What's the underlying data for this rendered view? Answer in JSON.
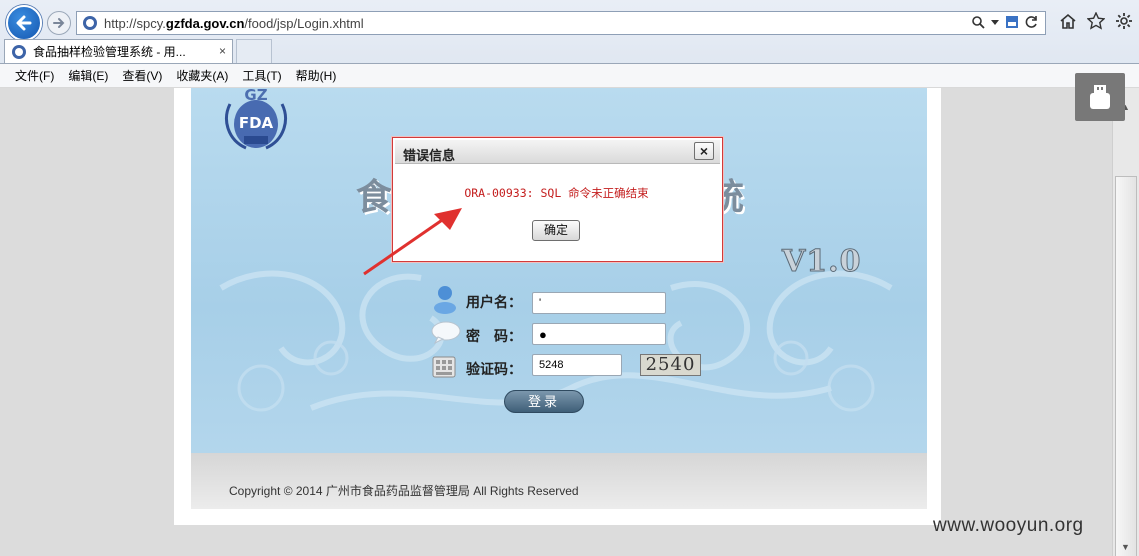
{
  "browser": {
    "url_prefix": "http://spcy.",
    "url_domain": "gzfda.gov.cn",
    "url_suffix": "/food/jsp/Login.xhtml",
    "tab_title": "食品抽样检验管理系统 - 用...",
    "tab_close": "×",
    "menu": [
      "文件(F)",
      "编辑(E)",
      "查看(V)",
      "收藏夹(A)",
      "工具(T)",
      "帮助(H)"
    ],
    "icons": [
      "back-arrow-icon",
      "forward-arrow-icon",
      "search-icon",
      "compatibility-icon",
      "refresh-icon",
      "home-icon",
      "favorites-star-icon",
      "settings-gear-icon"
    ]
  },
  "page": {
    "logo_text_top": "GZ",
    "logo_text_mid": "FDA",
    "title_left": "食",
    "title_right": "统",
    "version": "V1.0",
    "username_label": "用户名：",
    "username_value": "'",
    "password_label": "密　码：",
    "password_value": "●",
    "captcha_label": "验证码：",
    "captcha_value": "5248",
    "captcha_image_text": "2540",
    "login_button": "登录",
    "copyright": "Copyright © 2014 广州市食品药品监督管理局  All Rights Reserved"
  },
  "dialog": {
    "title": "错误信息",
    "close": "×",
    "message": "ORA-00933: SQL 命令未正确结束",
    "ok_button": "确定"
  },
  "watermark": "www.wooyun.org",
  "colors": {
    "error_text": "#c41e1e",
    "dialog_border": "#d23a3a",
    "annotation_arrow": "#e0312f",
    "login_bg": "#b4d7ed"
  }
}
